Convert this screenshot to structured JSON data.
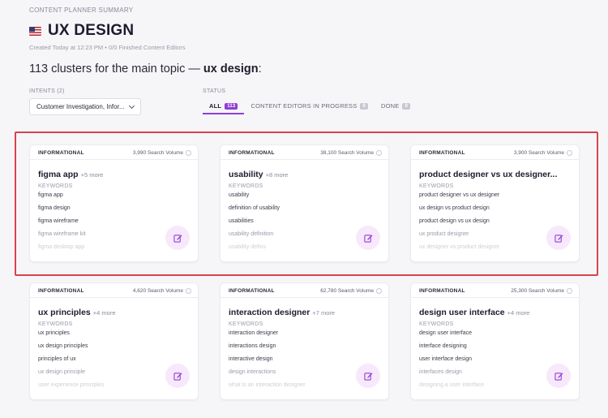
{
  "header": {
    "eyebrow": "CONTENT PLANNER SUMMARY",
    "title": "UX DESIGN",
    "meta": "Created Today at 12:23 PM • 0/0 Finished Content Editors",
    "headline_prefix": "113 clusters for the main topic —",
    "headline_topic": "ux design",
    "headline_suffix": ":"
  },
  "filters": {
    "intents_label": "INTENTS (2)",
    "intents_value": "Customer Investigation, Infor...",
    "status_label": "STATUS",
    "tabs": [
      {
        "label": "ALL",
        "count": "113"
      },
      {
        "label": "CONTENT EDITORS IN PROGRESS",
        "count": "0"
      },
      {
        "label": "DONE",
        "count": "0"
      }
    ]
  },
  "keywords_label": "KEYWORDS",
  "cards": [
    {
      "intent": "INFORMATIONAL",
      "volume": "3,990 Search Volume",
      "title": "figma app",
      "more": "+5 more",
      "keywords": [
        "figma app",
        "figma design",
        "figma wireframe",
        "figma wireframe kit",
        "figma desktop app"
      ]
    },
    {
      "intent": "INFORMATIONAL",
      "volume": "38,100 Search Volume",
      "title": "usability",
      "more": "+8 more",
      "keywords": [
        "usability",
        "definition of usability",
        "usabilities",
        "usability definition",
        "usability defins"
      ]
    },
    {
      "intent": "INFORMATIONAL",
      "volume": "3,900 Search Volume",
      "title": "product designer vs ux designer...",
      "more": "",
      "keywords": [
        "product designer vs ux designer",
        "ux design vs product design",
        "product design vs ux design",
        "ux product designer",
        "ux designer vs product designer"
      ]
    },
    {
      "intent": "INFORMATIONAL",
      "volume": "4,620 Search Volume",
      "title": "ux principles",
      "more": "+4 more",
      "keywords": [
        "ux principles",
        "ux design principles",
        "principles of ux",
        "ux design principle",
        "user experience principles"
      ]
    },
    {
      "intent": "INFORMATIONAL",
      "volume": "62,780 Search Volume",
      "title": "interaction designer",
      "more": "+7 more",
      "keywords": [
        "interaction designer",
        "interactions design",
        "interactive design",
        "design interactions",
        "what is an interaction designer"
      ]
    },
    {
      "intent": "INFORMATIONAL",
      "volume": "25,300 Search Volume",
      "title": "design user interface",
      "more": "+4 more",
      "keywords": [
        "design user interface",
        "interface designing",
        "user interface design",
        "interfaces design",
        "designing a user interface"
      ]
    }
  ],
  "colors": {
    "accent": "#8f3fd6",
    "highlight": "#d9434b"
  },
  "icons": {
    "flag": "us-flag-icon",
    "edit": "edit-icon",
    "info": "info-icon",
    "dropdown": "chevron-down-icon"
  }
}
